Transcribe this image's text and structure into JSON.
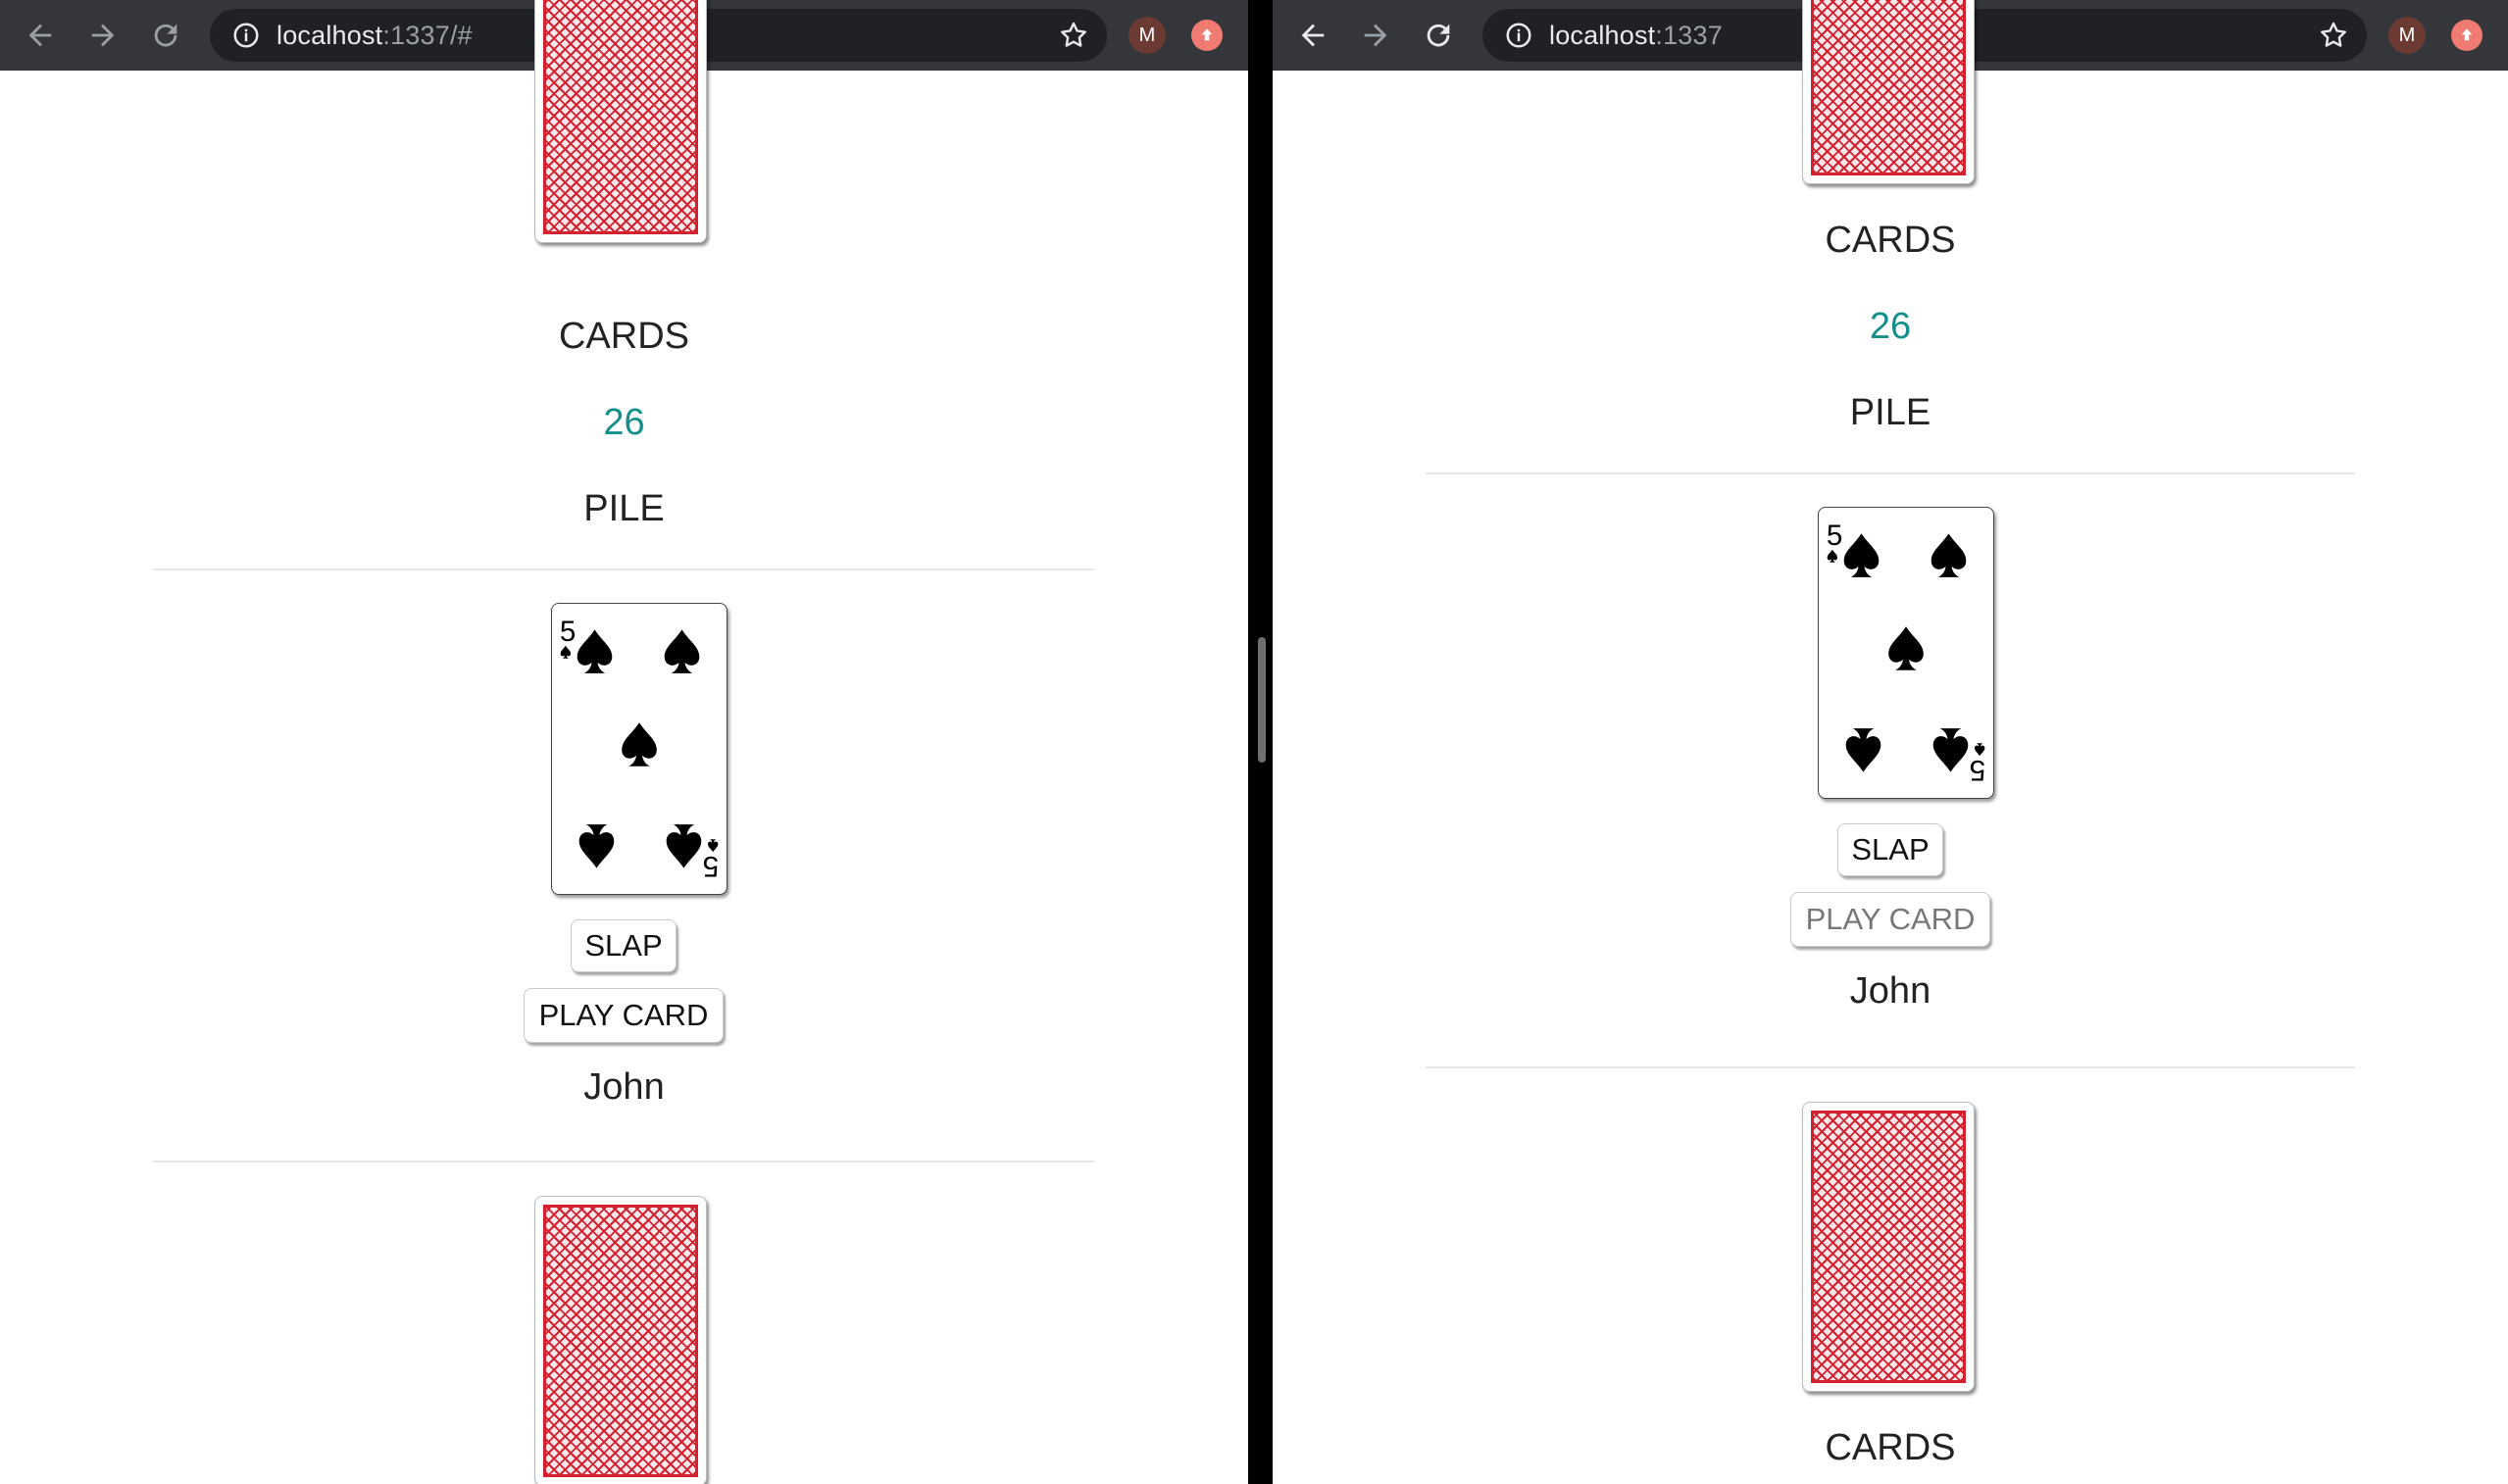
{
  "left": {
    "url": {
      "host": "localhost",
      "rest": ":1337/#"
    },
    "avatar": "M",
    "pile_top_label": "CARDS",
    "pile_count": "26",
    "pile_label": "PILE",
    "player": {
      "card": "5 of spades",
      "rank": "5",
      "slap": "SLAP",
      "play": "PLAY CARD",
      "name": "John"
    }
  },
  "right": {
    "url": {
      "host": "localhost",
      "rest": ":1337"
    },
    "avatar": "M",
    "pile_top_label": "CARDS",
    "pile_count": "26",
    "pile_label": "PILE",
    "player": {
      "card": "5 of spades",
      "rank": "5",
      "slap": "SLAP",
      "play": "PLAY CARD",
      "name": "John"
    },
    "bottom_label": "CARDS"
  },
  "colors": {
    "count": "#14908c",
    "card_back": "#d42130",
    "toolbar": "#35363a"
  }
}
